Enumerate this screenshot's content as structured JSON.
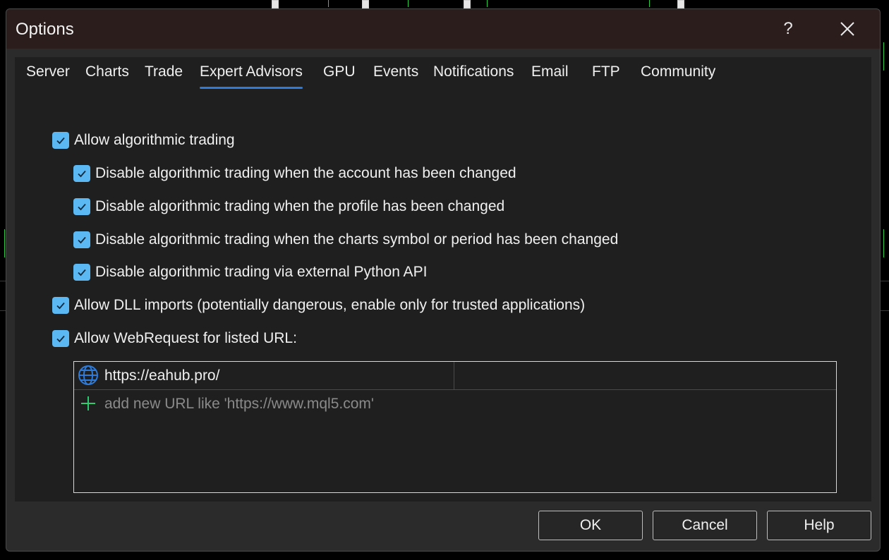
{
  "window": {
    "title": "Options",
    "help_glyph": "?",
    "help_icon": "question-mark-icon",
    "close_icon": "close-icon"
  },
  "tabs": [
    {
      "label": "Server"
    },
    {
      "label": "Charts"
    },
    {
      "label": "Trade"
    },
    {
      "label": "Expert Advisors",
      "active": true
    },
    {
      "label": "GPU"
    },
    {
      "label": "Events"
    },
    {
      "label": "Notifications"
    },
    {
      "label": "Email"
    },
    {
      "label": "FTP"
    },
    {
      "label": "Community"
    }
  ],
  "options": [
    {
      "label": "Allow algorithmic trading",
      "checked": true
    },
    {
      "label": "Disable algorithmic trading when the account has been changed",
      "checked": true
    },
    {
      "label": "Disable algorithmic trading when the profile has been changed",
      "checked": true
    },
    {
      "label": "Disable algorithmic trading when the charts symbol or period has been changed",
      "checked": true
    },
    {
      "label": "Disable algorithmic trading via external Python API",
      "checked": true
    },
    {
      "label": "Allow DLL imports (potentially dangerous, enable only for trusted applications)",
      "checked": true
    },
    {
      "label": "Allow WebRequest for listed URL:",
      "checked": true
    }
  ],
  "url_list": {
    "entries": [
      {
        "url": "https://eahub.pro/",
        "icon": "globe-icon"
      }
    ],
    "add_placeholder": "add new URL like 'https://www.mql5.com'",
    "add_icon": "plus-icon"
  },
  "buttons": {
    "ok": "OK",
    "cancel": "Cancel",
    "help": "Help"
  },
  "colors": {
    "accent": "#2f7bd9",
    "checkbox": "#5bb8f2",
    "add_icon": "#2ecc71",
    "globe": "#2f7bd9"
  }
}
